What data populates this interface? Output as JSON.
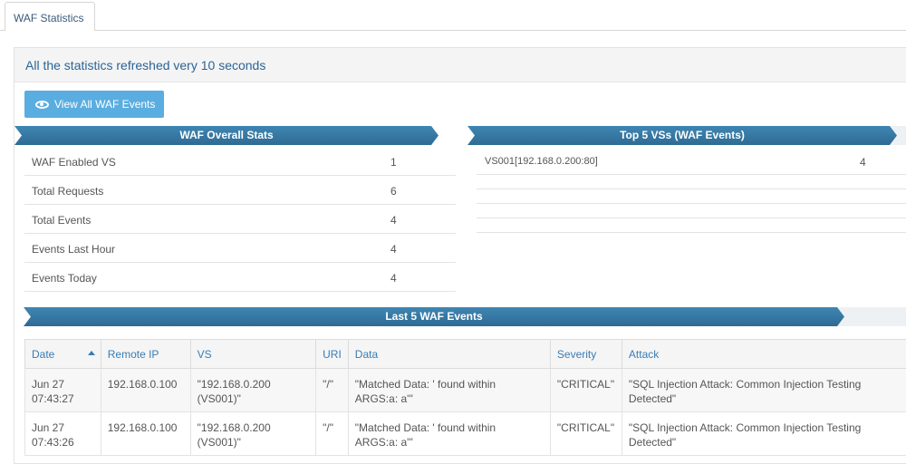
{
  "tabs": [
    {
      "label": "WAF Statistics"
    }
  ],
  "panel": {
    "heading": "All the statistics refreshed very 10 seconds"
  },
  "actions": {
    "view_all_label": "View All WAF Events",
    "view_all_icon": "eye-icon"
  },
  "overall": {
    "title": "WAF Overall Stats",
    "rows": [
      {
        "label": "WAF Enabled VS",
        "value": "1"
      },
      {
        "label": "Total Requests",
        "value": "6"
      },
      {
        "label": "Total Events",
        "value": "4"
      },
      {
        "label": "Events Last Hour",
        "value": "4"
      },
      {
        "label": "Events Today",
        "value": "4"
      }
    ]
  },
  "top5": {
    "title": "Top 5 VSs (WAF Events)",
    "rows": [
      {
        "label": "VS001[192.168.0.200:80]",
        "value": "4"
      },
      {
        "label": "",
        "value": ""
      },
      {
        "label": "",
        "value": ""
      },
      {
        "label": "",
        "value": ""
      },
      {
        "label": "",
        "value": ""
      }
    ]
  },
  "last5": {
    "title": "Last 5 WAF Events",
    "columns": [
      "Date",
      "Remote IP",
      "VS",
      "URI",
      "Data",
      "Severity",
      "Attack"
    ],
    "sort_column": "Date",
    "rows": [
      {
        "date_line1": "Jun 27",
        "date_line2": "07:43:27",
        "remote_ip": "192.168.0.100",
        "vs_line1": "\"192.168.0.200",
        "vs_line2": "(VS001)\"",
        "uri": "\"/\"",
        "data_line1": "\"Matched Data: ' found within",
        "data_line2": "ARGS:a: a'\"",
        "severity": "\"CRITICAL\"",
        "attack_line1": "\"SQL Injection Attack: Common Injection Testing",
        "attack_line2": "Detected\""
      },
      {
        "date_line1": "Jun 27",
        "date_line2": "07:43:26",
        "remote_ip": "192.168.0.100",
        "vs_line1": "\"192.168.0.200",
        "vs_line2": "(VS001)\"",
        "uri": "\"/\"",
        "data_line1": "\"Matched Data: ' found within",
        "data_line2": "ARGS:a: a'\"",
        "severity": "\"CRITICAL\"",
        "attack_line1": "\"SQL Injection Attack: Common Injection Testing",
        "attack_line2": "Detected\""
      }
    ]
  },
  "colors": {
    "accent": "#3a7cb5",
    "ribbon": "#2e6b94",
    "button": "#5aade0"
  }
}
